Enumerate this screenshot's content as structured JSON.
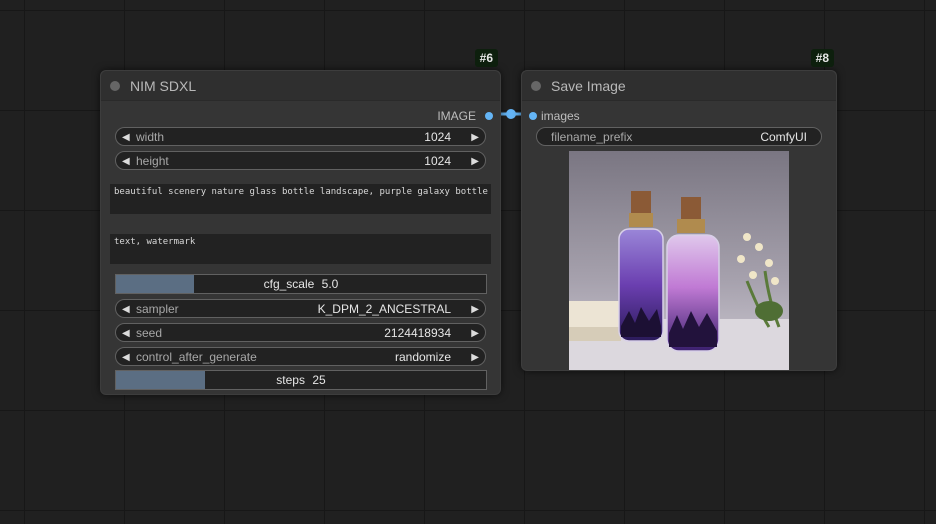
{
  "node_nim": {
    "id_badge": "#6",
    "title": "NIM SDXL",
    "output_label": "IMAGE",
    "widgets": {
      "width": {
        "label": "width",
        "value": "1024"
      },
      "height": {
        "label": "height",
        "value": "1024"
      },
      "sampler": {
        "label": "sampler",
        "value": "K_DPM_2_ANCESTRAL"
      },
      "seed": {
        "label": "seed",
        "value": "2124418934"
      },
      "control_after_generate": {
        "label": "control_after_generate",
        "value": "randomize"
      }
    },
    "prompt_positive": "beautiful scenery nature glass bottle landscape, purple galaxy bottle",
    "prompt_negative": "text, watermark",
    "cfg_scale": {
      "label": "cfg_scale",
      "value": "5.0",
      "fill_fraction": 0.21
    },
    "steps": {
      "label": "steps",
      "value": "25",
      "fill_fraction": 0.24
    }
  },
  "node_save": {
    "id_badge": "#8",
    "title": "Save Image",
    "input_label": "images",
    "filename_prefix": {
      "label": "filename_prefix",
      "value": "ComfyUI"
    },
    "preview_description": "Two glass bottles with cork stoppers containing purple galaxy and pine tree scenery"
  },
  "colors": {
    "canvas": "#202020",
    "node_body": "#353535",
    "link": "#64b5f6",
    "slider_fill": "#5b6e83",
    "badge_bg": "#0d1f0d"
  }
}
